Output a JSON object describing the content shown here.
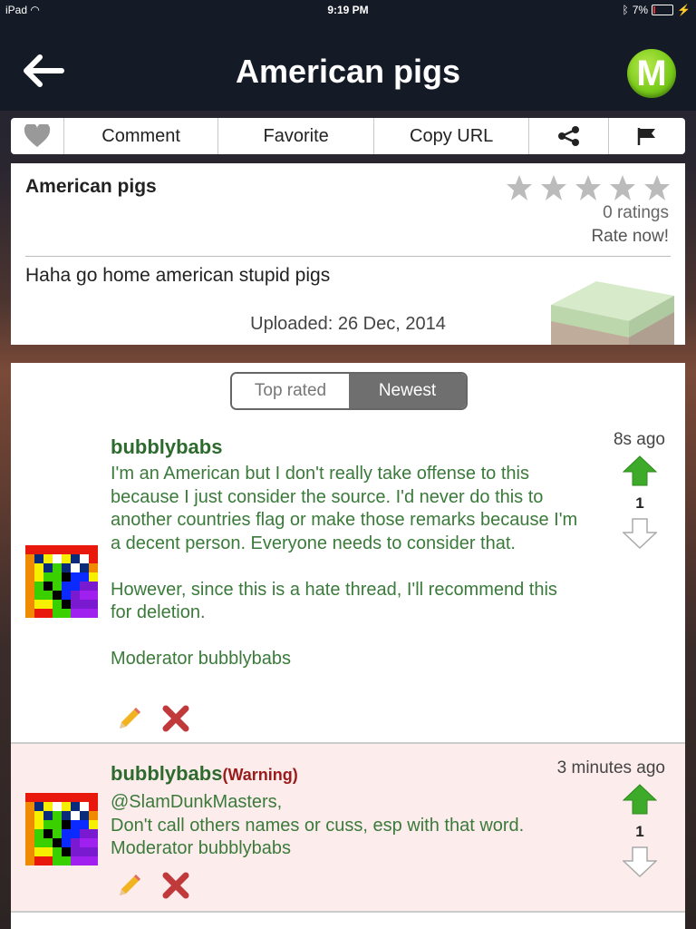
{
  "status": {
    "device": "iPad",
    "time": "9:19 PM",
    "battery": "7%"
  },
  "nav": {
    "title": "American pigs",
    "logo_letter": "M"
  },
  "toolbar": {
    "comment": "Comment",
    "favorite": "Favorite",
    "copy_url": "Copy URL"
  },
  "post": {
    "title": "American pigs",
    "ratings": "0 ratings",
    "rate_now": "Rate now!",
    "description": "Haha go home american stupid pigs",
    "uploaded": "Uploaded: 26 Dec, 2014",
    "rating_value": 0
  },
  "sort": {
    "top_rated": "Top rated",
    "newest": "Newest",
    "selected": "Newest"
  },
  "comments": [
    {
      "user": "bubblybabs",
      "time": "8s ago",
      "votes": "1",
      "body": "I'm an American but I don't really take offense to this because I just consider the source. I'd never do this to another countries flag or make those remarks because I'm a decent person. Everyone needs to consider that.\n\nHowever, since this is a hate thread, I'll recommend this for deletion.\n\nModerator bubblybabs"
    },
    {
      "user": "bubblybabs",
      "warning": "(Warning)",
      "time": "3 minutes ago",
      "votes": "1",
      "body": "@SlamDunkMasters,\nDon't call others names or cuss, esp with that word.\nModerator bubblybabs"
    }
  ],
  "colors": {
    "accent_green": "#3a7a3a",
    "username_green": "#2d6a2d",
    "warning_red": "#9a1b1b",
    "highlight_bg": "#fdecec"
  }
}
